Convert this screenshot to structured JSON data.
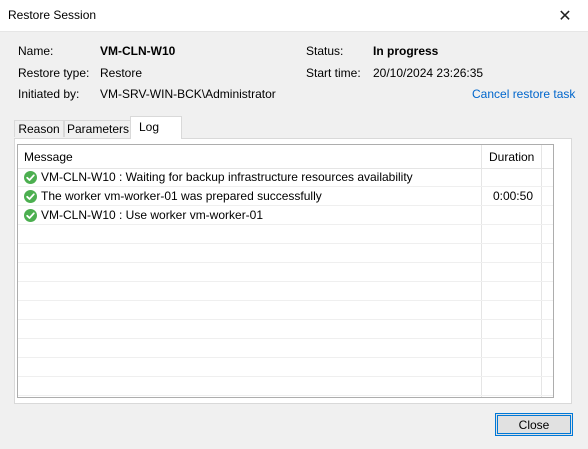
{
  "window": {
    "title": "Restore Session",
    "close_glyph": "✕"
  },
  "info": {
    "name_label": "Name:",
    "name_value": "VM-CLN-W10",
    "restore_type_label": "Restore type:",
    "restore_type_value": "Restore",
    "initiated_by_label": "Initiated by:",
    "initiated_by_value": "VM-SRV-WIN-BCK\\Administrator",
    "status_label": "Status:",
    "status_value": "In progress",
    "start_time_label": "Start time:",
    "start_time_value": "20/10/2024 23:26:35",
    "cancel_link": "Cancel restore task"
  },
  "tabs": [
    {
      "label": "Reason"
    },
    {
      "label": "Parameters"
    },
    {
      "label": "Log",
      "active": true
    }
  ],
  "log": {
    "columns": {
      "message": "Message",
      "duration": "Duration"
    },
    "rows": [
      {
        "status_icon": "success-check-icon",
        "message": "VM-CLN-W10 : Waiting for backup infrastructure resources availability",
        "duration": ""
      },
      {
        "status_icon": "success-check-icon",
        "message": "The worker vm-worker-01 was prepared successfully",
        "duration": "0:00:50"
      },
      {
        "status_icon": "success-check-icon",
        "message": "VM-CLN-W10 : Use worker vm-worker-01",
        "duration": ""
      }
    ]
  },
  "footer": {
    "close_label": "Close"
  },
  "colors": {
    "accent": "#0078d7",
    "link": "#0066cc",
    "success": "#4caf50"
  }
}
